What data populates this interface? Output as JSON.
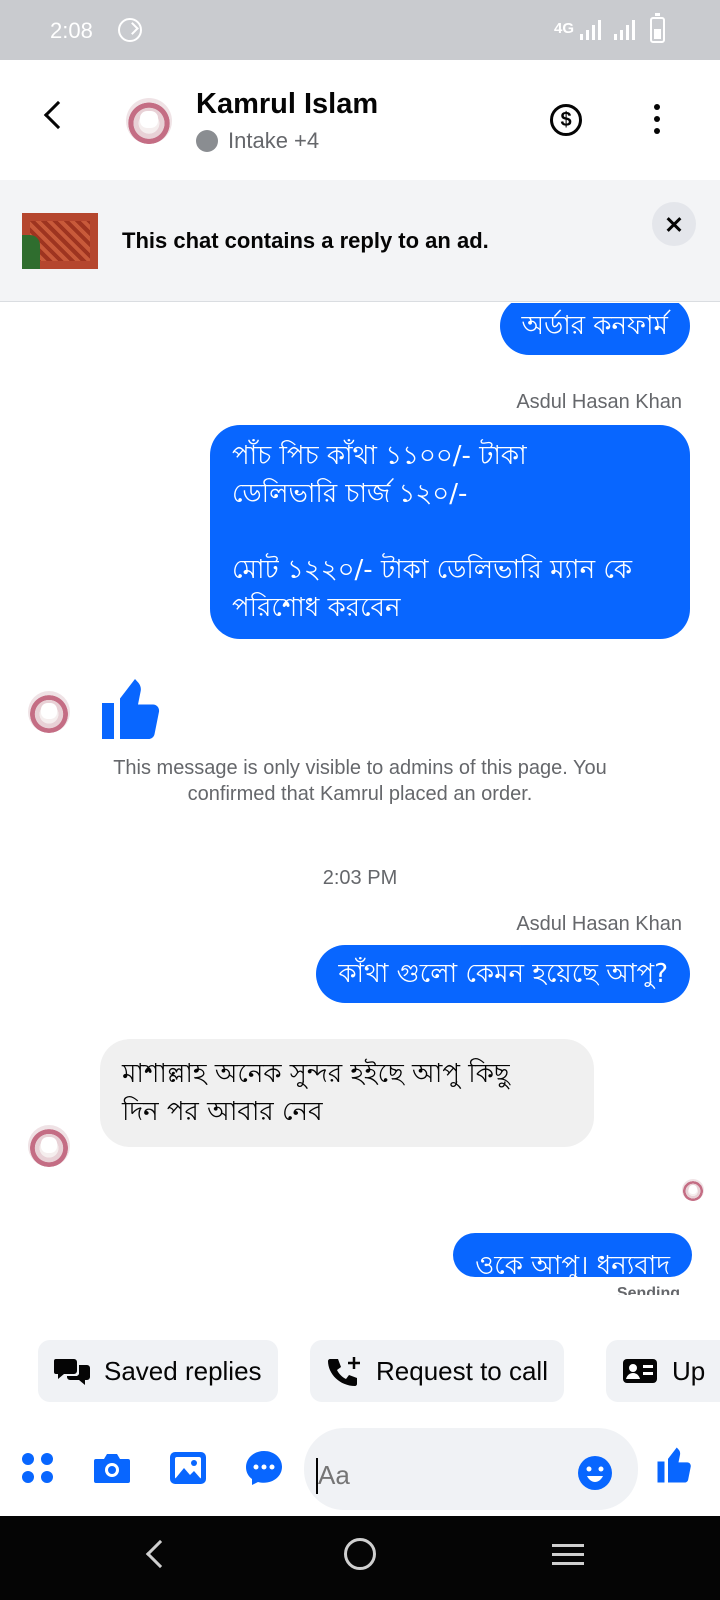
{
  "status_bar": {
    "time": "2:08",
    "network": "4G"
  },
  "header": {
    "name": "Kamrul Islam",
    "status": "Intake +4",
    "icons": [
      "back-icon",
      "dollar-icon",
      "more-icon"
    ]
  },
  "ad_banner": {
    "text": "This chat contains a reply to an ad."
  },
  "messages": [
    {
      "type": "outgoing",
      "text": "অর্ডার কনফার্ম"
    },
    {
      "type": "sender",
      "text": "Asdul Hasan Khan"
    },
    {
      "type": "outgoing",
      "text": "পাঁচ পিচ কাঁথা ১১০০/- টাকা\nডেলিভারি চার্জ ১২০/-\n\nমোট ১২২০/- টাকা ডেলিভারি ম্যান কে\nপরিশোধ করবেন"
    },
    {
      "type": "incoming-like",
      "icon": "thumbs-up-icon"
    },
    {
      "type": "note",
      "text": "This message is only visible to admins of this page. You confirmed that Kamrul placed an order."
    },
    {
      "type": "timestamp",
      "text": "2:03 PM"
    },
    {
      "type": "sender",
      "text": "Asdul Hasan Khan"
    },
    {
      "type": "outgoing",
      "text": "কাঁথা গুলো কেমন হয়েছে আপু?"
    },
    {
      "type": "incoming",
      "text": "মাশাল্লাহ অনেক সুন্দর হইছে আপু কিছু\nদিন পর আবার নেব"
    },
    {
      "type": "outgoing",
      "text": "ওকে আপু। ধন্যবাদ"
    },
    {
      "type": "status",
      "text": "Sending"
    }
  ],
  "quick_replies": [
    {
      "label": "Saved replies",
      "icon": "saved-replies-icon"
    },
    {
      "label": "Request to call",
      "icon": "phone-plus-icon"
    },
    {
      "label": "Up",
      "icon": "contact-card-icon"
    }
  ],
  "composer": {
    "placeholder": "Aa",
    "icons": [
      "apps-icon",
      "camera-icon",
      "gallery-icon",
      "chat-bubble-icon",
      "emoji-icon",
      "thumbs-up-icon"
    ]
  },
  "colors": {
    "accent": "#0866ff",
    "incoming_bubble": "#f0f0f0",
    "status_bar": "#c9cbcf",
    "nav_bar": "#050505"
  }
}
